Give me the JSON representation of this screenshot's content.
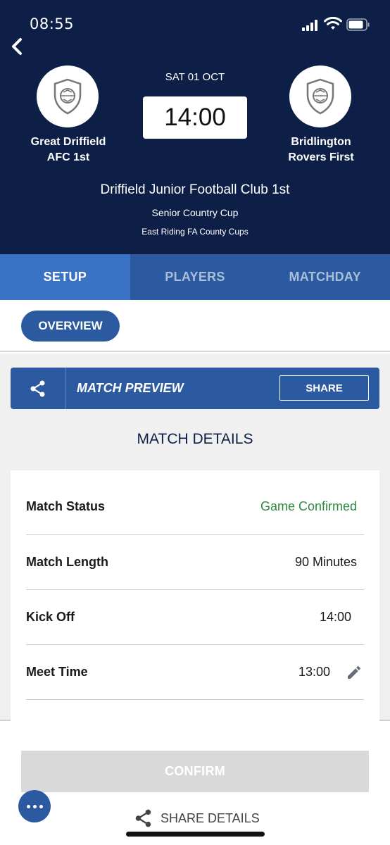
{
  "status_bar": {
    "time": "08:55"
  },
  "header": {
    "date": "SAT 01 OCT",
    "kick_off": "14:00",
    "home_team": {
      "line1": "Great Driffield",
      "line2": "AFC 1st"
    },
    "away_team": {
      "line1": "Bridlington",
      "line2": "Rovers First"
    },
    "club": "Driffield Junior Football Club 1st",
    "competition": "Senior Country Cup",
    "league": "East Riding FA County Cups"
  },
  "tabs": [
    {
      "label": "SETUP",
      "active": true
    },
    {
      "label": "PLAYERS",
      "active": false
    },
    {
      "label": "MATCHDAY",
      "active": false
    }
  ],
  "sub_nav": {
    "overview_label": "OVERVIEW"
  },
  "preview": {
    "title": "MATCH PREVIEW",
    "share_label": "SHARE"
  },
  "details": {
    "title": "MATCH DETAILS",
    "rows": [
      {
        "label": "Match Status",
        "value": "Game Confirmed"
      },
      {
        "label": "Match Length",
        "value": "90 Minutes"
      },
      {
        "label": "Kick Off",
        "value": "14:00"
      },
      {
        "label": "Meet Time",
        "value": "13:00"
      }
    ]
  },
  "footer": {
    "confirm_label": "CONFIRM",
    "share_details_label": "SHARE DETAILS"
  },
  "colors": {
    "header_bg": "#0e1f47",
    "primary_blue": "#2c5aa0",
    "active_tab": "#3a72c4",
    "status_green": "#2e8b3e",
    "disabled_button": "#d9d9d9"
  },
  "icons": {
    "back": "chevron-left-icon",
    "crest": "shield-ball-icon",
    "share": "share-icon",
    "edit": "pencil-icon",
    "more": "more-dots-icon"
  }
}
